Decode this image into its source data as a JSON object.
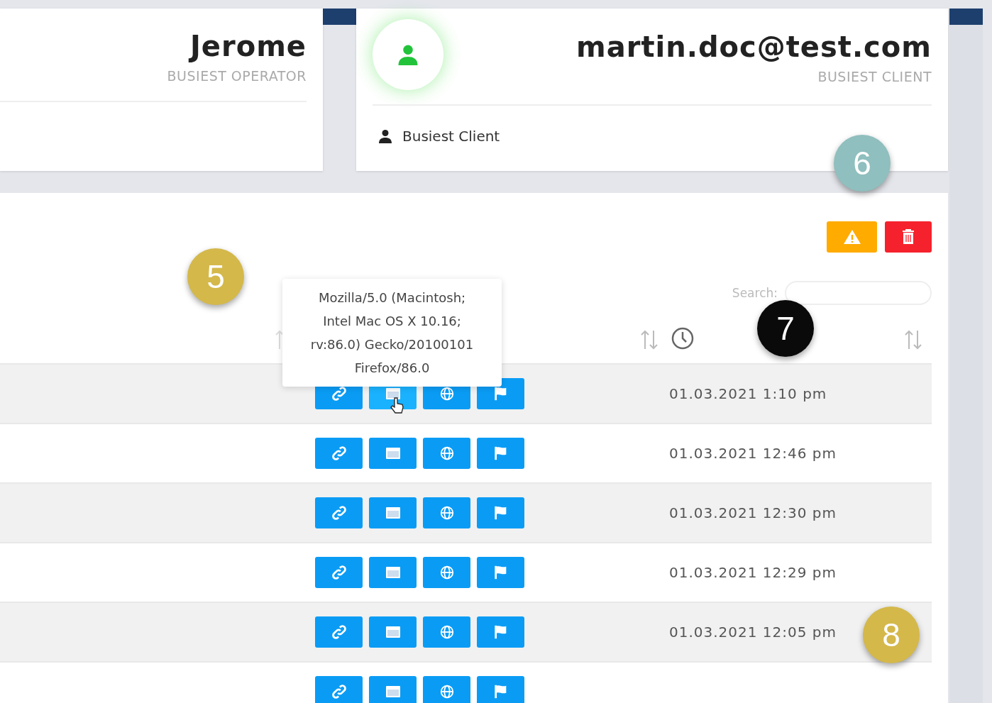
{
  "operator_card": {
    "name": "Jerome",
    "caption": "BUSIEST OPERATOR"
  },
  "client_card": {
    "email": "martin.doc@test.com",
    "caption": "BUSIEST CLIENT",
    "footer": "Busiest Client"
  },
  "toolbar": {
    "buttons": [
      {
        "kind": "warning"
      },
      {
        "kind": "delete"
      }
    ]
  },
  "search": {
    "label": "Search:"
  },
  "tooltip": {
    "lines": [
      "Mozilla/5.0 (Macintosh;",
      "Intel Mac OS X 10.16;",
      "rv:86.0) Gecko/20100101",
      "Firefox/86.0"
    ]
  },
  "rows": [
    {
      "time": "01.03.2021 1:10 pm",
      "actions": [
        {
          "kind": "link",
          "highlighted": false
        },
        {
          "kind": "browser",
          "highlighted": true
        },
        {
          "kind": "globe",
          "highlighted": false
        },
        {
          "kind": "flag",
          "highlighted": false
        }
      ]
    },
    {
      "time": "01.03.2021 12:46 pm",
      "actions": [
        {
          "kind": "link",
          "highlighted": false
        },
        {
          "kind": "browser",
          "highlighted": false
        },
        {
          "kind": "globe",
          "highlighted": false
        },
        {
          "kind": "flag",
          "highlighted": false
        }
      ]
    },
    {
      "time": "01.03.2021 12:30 pm",
      "actions": [
        {
          "kind": "link",
          "highlighted": false
        },
        {
          "kind": "browser",
          "highlighted": false
        },
        {
          "kind": "globe",
          "highlighted": false
        },
        {
          "kind": "flag",
          "highlighted": false
        }
      ]
    },
    {
      "time": "01.03.2021 12:29 pm",
      "actions": [
        {
          "kind": "link",
          "highlighted": false
        },
        {
          "kind": "browser",
          "highlighted": false
        },
        {
          "kind": "globe",
          "highlighted": false
        },
        {
          "kind": "flag",
          "highlighted": false
        }
      ]
    },
    {
      "time": "01.03.2021 12:05 pm",
      "actions": [
        {
          "kind": "link",
          "highlighted": false
        },
        {
          "kind": "browser",
          "highlighted": false
        },
        {
          "kind": "globe",
          "highlighted": false
        },
        {
          "kind": "flag",
          "highlighted": false
        }
      ]
    },
    {
      "actions": [
        {
          "kind": "link",
          "highlighted": false
        },
        {
          "kind": "browser",
          "highlighted": false
        },
        {
          "kind": "globe",
          "highlighted": false
        },
        {
          "kind": "flag",
          "highlighted": false
        }
      ]
    }
  ],
  "callouts": [
    {
      "label": "5",
      "color": "#d4b84a"
    },
    {
      "label": "6",
      "color": "#8fbfbe"
    },
    {
      "label": "7",
      "color": "#0a0a0a"
    },
    {
      "label": "8",
      "color": "#d4b84a"
    }
  ]
}
